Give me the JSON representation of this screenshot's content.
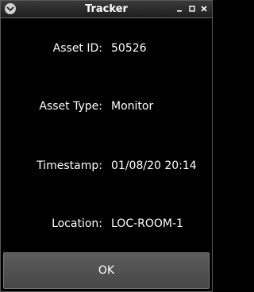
{
  "window": {
    "title": "Tracker",
    "app_icon": "chevron-down-icon",
    "controls": {
      "minimize": "minimize-icon",
      "maximize": "maximize-icon",
      "close": "close-icon"
    },
    "colors": {
      "background": "#000000",
      "text": "#ffffff",
      "button": "#555555"
    }
  },
  "fields": [
    {
      "label": "Asset ID:",
      "value": "50526"
    },
    {
      "label": "Asset Type:",
      "value": "Monitor"
    },
    {
      "label": "Timestamp:",
      "value": "01/08/20 20:14"
    },
    {
      "label": "Location:",
      "value": "LOC-ROOM-1"
    }
  ],
  "actions": {
    "ok_label": "OK"
  }
}
